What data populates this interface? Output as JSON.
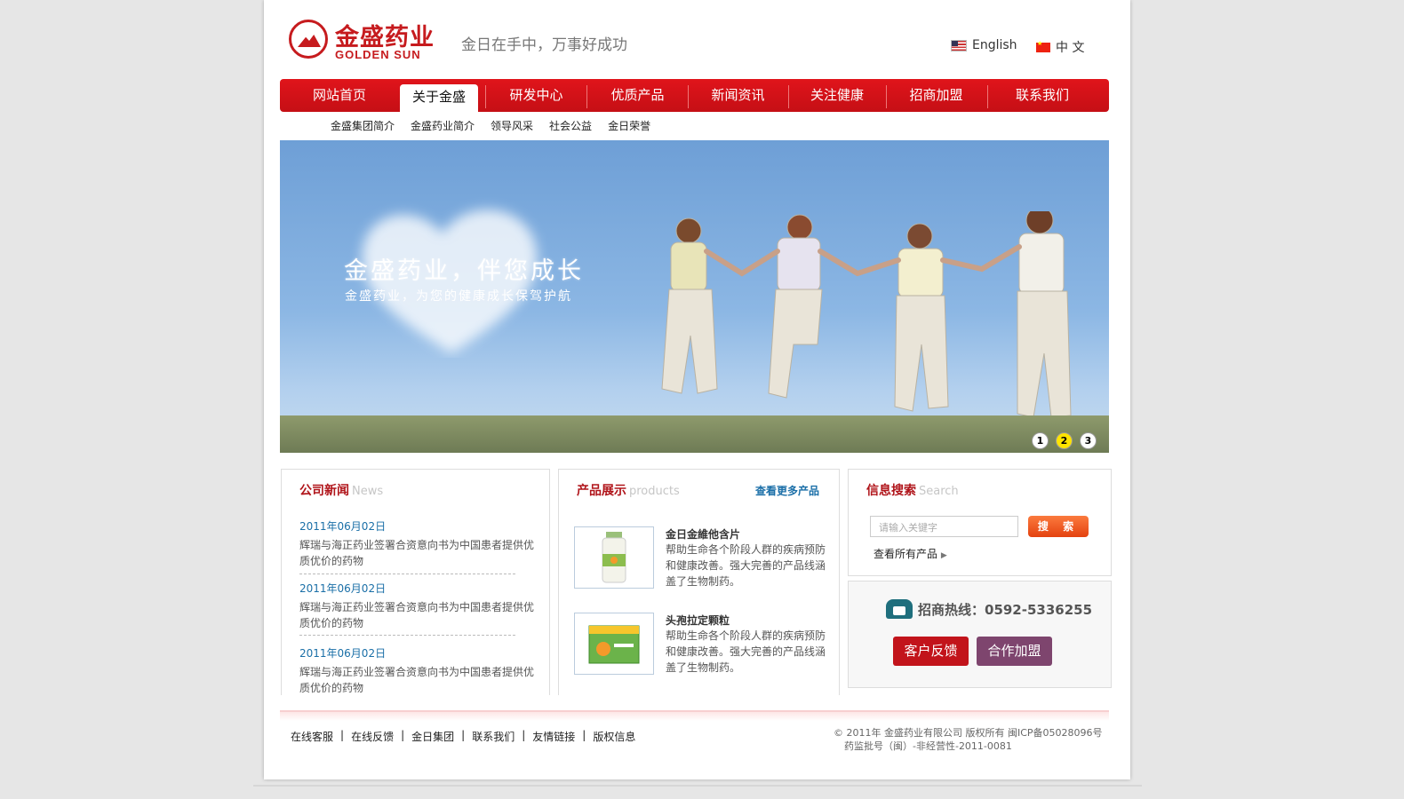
{
  "header": {
    "logo_cn": "金盛药业",
    "logo_en": "GOLDEN SUN",
    "slogan": "金日在手中，万事好成功",
    "lang_en": "English",
    "lang_cn": "中 文"
  },
  "nav": {
    "items": [
      "网站首页",
      "关于金盛",
      "研发中心",
      "优质产品",
      "新闻资讯",
      "关注健康",
      "招商加盟",
      "联系我们"
    ],
    "active": "关于金盛"
  },
  "subnav": [
    "金盛集团简介",
    "金盛药业简介",
    "领导风采",
    "社会公益",
    "金日荣誉"
  ],
  "banner": {
    "title": "金盛药业，伴您成长",
    "subtitle": "金盛药业，为您的健康成长保驾护航",
    "pages": [
      "1",
      "2",
      "3"
    ],
    "active_page": "2"
  },
  "news": {
    "title": "公司新闻",
    "title_en": "News",
    "items": [
      {
        "date": "2011年06月02日",
        "title": "辉瑞与海正药业签署合资意向书为中国患者提供优质优价的药物"
      },
      {
        "date": "2011年06月02日",
        "title": "辉瑞与海正药业签署合资意向书为中国患者提供优质优价的药物"
      },
      {
        "date": "2011年06月02日",
        "title": "辉瑞与海正药业签署合资意向书为中国患者提供优质优价的药物"
      }
    ]
  },
  "products": {
    "title": "产品展示",
    "title_en": "products",
    "more": "查看更多产品",
    "items": [
      {
        "name": "金日金維他含片",
        "desc": "帮助生命各个阶段人群的疾病预防和健康改善。强大完善的产品线涵盖了生物制药。"
      },
      {
        "name": "头孢拉定颗粒",
        "desc": "帮助生命各个阶段人群的疾病预防和健康改善。强大完善的产品线涵盖了生物制药。"
      }
    ]
  },
  "search": {
    "title": "信息搜索",
    "title_en": "Search",
    "placeholder": "请输入关键字",
    "button": "搜 索",
    "all_products": "查看所有产品"
  },
  "contact": {
    "hotline": "招商热线：0592-5336255",
    "feedback": "客户反馈",
    "join": "合作加盟"
  },
  "footer": {
    "links": [
      "在线客服",
      "在线反馈",
      "金日集团",
      "联系我们",
      "友情链接",
      "版权信息"
    ],
    "copyright_1": "© 2011年  金盛药业有限公司  版权所有  闽ICP备05028096号",
    "copyright_2": "药监批号（闽）-非经营性-2011-0081"
  },
  "colors": {
    "brand_red": "#c61b1e",
    "nav_red": "#e0141b",
    "link_blue": "#1a6fa7",
    "join_purple": "#7e456e",
    "search_orange": "#f2642a"
  }
}
